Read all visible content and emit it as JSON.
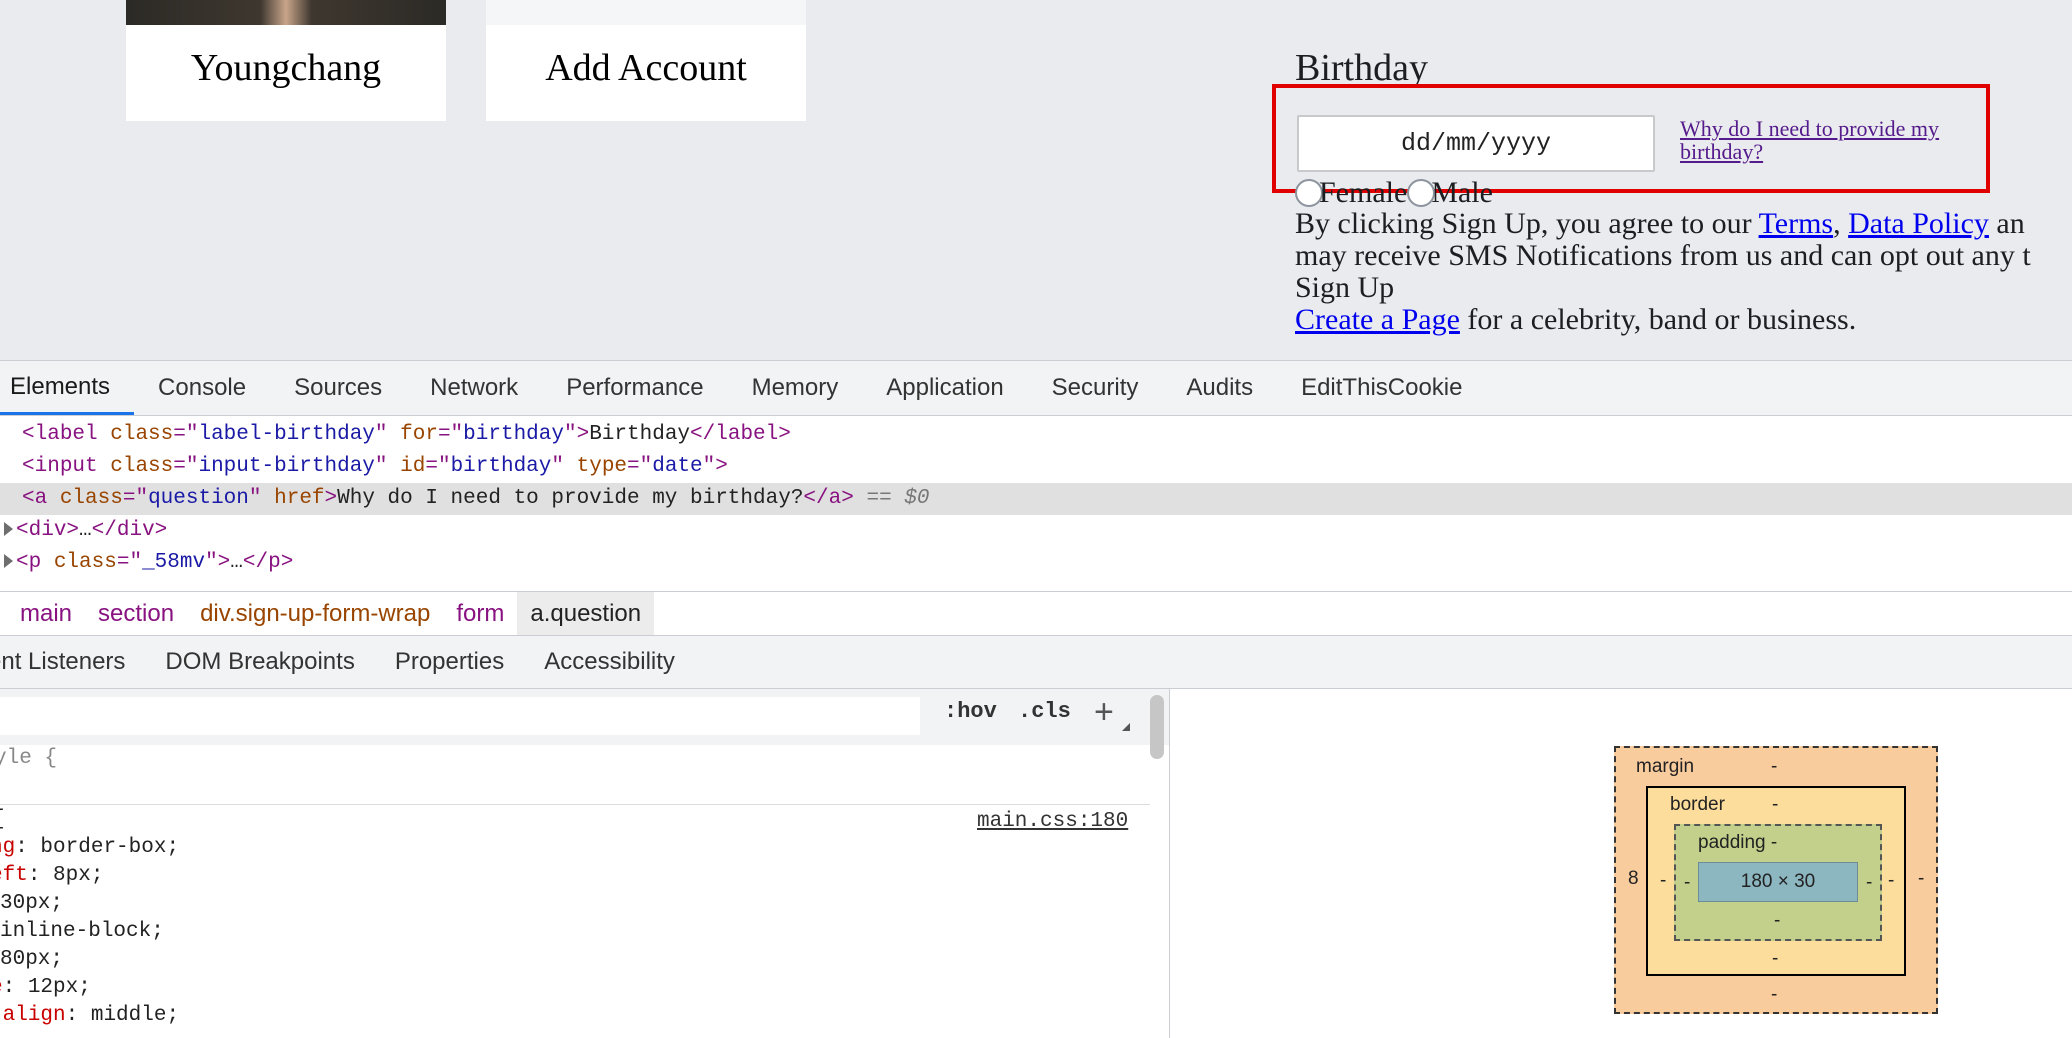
{
  "page": {
    "accounts": [
      {
        "name": "Youngchang"
      },
      {
        "name": "Add Account"
      }
    ],
    "birthday_label": "Birthday",
    "birthday_placeholder": "dd/mm/yyyy",
    "question_link": "Why do I need to provide my birthday?",
    "gender_options": [
      "Female",
      "Male"
    ],
    "terms": {
      "prefix": "By clicking Sign Up, you agree to our ",
      "terms_link": "Terms",
      "comma": ", ",
      "data_policy_link": "Data Policy",
      "suffix": " an",
      "line2": "may receive SMS Notifications from us and can opt out any t",
      "signup": "Sign Up",
      "create_page_link": "Create a Page",
      "create_page_suffix": " for a celebrity, band or business."
    },
    "highlight_color": "#e00000"
  },
  "devtools": {
    "tabs": [
      "Elements",
      "Console",
      "Sources",
      "Network",
      "Performance",
      "Memory",
      "Application",
      "Security",
      "Audits",
      "EditThisCookie"
    ],
    "active_tab": "Elements",
    "dom": {
      "line1": {
        "tag": "label",
        "attr1": "class",
        "val1": "label-birthday",
        "attr2": "for",
        "val2": "birthday",
        "text": "Birthday"
      },
      "line2": {
        "tag": "input",
        "attr1": "class",
        "val1": "input-birthday",
        "attr2": "id",
        "val2": "birthday",
        "attr3": "type",
        "val3": "date"
      },
      "line3": {
        "tag": "a",
        "attr1": "class",
        "val1": "question",
        "attr2": "href",
        "text": "Why do I need to provide my birthday?",
        "marker": "== $0"
      },
      "line4": {
        "tag": "div",
        "ellipsis": "…"
      },
      "line5": {
        "tag": "p",
        "attr1": "class",
        "val1": "_58mv",
        "ellipsis": "…"
      }
    },
    "breadcrumb": [
      "main",
      "section",
      "div.sign-up-form-wrap",
      "form",
      "a.question"
    ],
    "subtabs": [
      "ent Listeners",
      "DOM Breakpoints",
      "Properties",
      "Accessibility"
    ],
    "styles": {
      "hov": ":hov",
      "cls": ".cls",
      "plus": "+",
      "element_style_partial": "yle {",
      "source": "main.css:180",
      "open_brace": "{",
      "declarations": [
        {
          "prop": "ng",
          "value": " border-box;"
        },
        {
          "prop": "eft",
          "value": " 8px;"
        },
        {
          "prop": "",
          "value": "30px;"
        },
        {
          "prop": "",
          "value": " inline-block;"
        },
        {
          "prop": "",
          "value": "80px;"
        },
        {
          "prop": "e",
          "value": " 12px;"
        },
        {
          "prop": "-align",
          "value": " middle;"
        }
      ]
    },
    "box_model": {
      "margin_label": "margin",
      "margin_top": "-",
      "margin_bottom": "-",
      "margin_left": "8",
      "margin_right": "-",
      "border_label": "border",
      "border_top": "-",
      "border_bottom": "-",
      "border_left": "-",
      "border_right": "-",
      "padding_label": "padding -",
      "padding_bottom": "-",
      "padding_left": "-",
      "padding_right": "-",
      "content": "180 × 30"
    }
  }
}
